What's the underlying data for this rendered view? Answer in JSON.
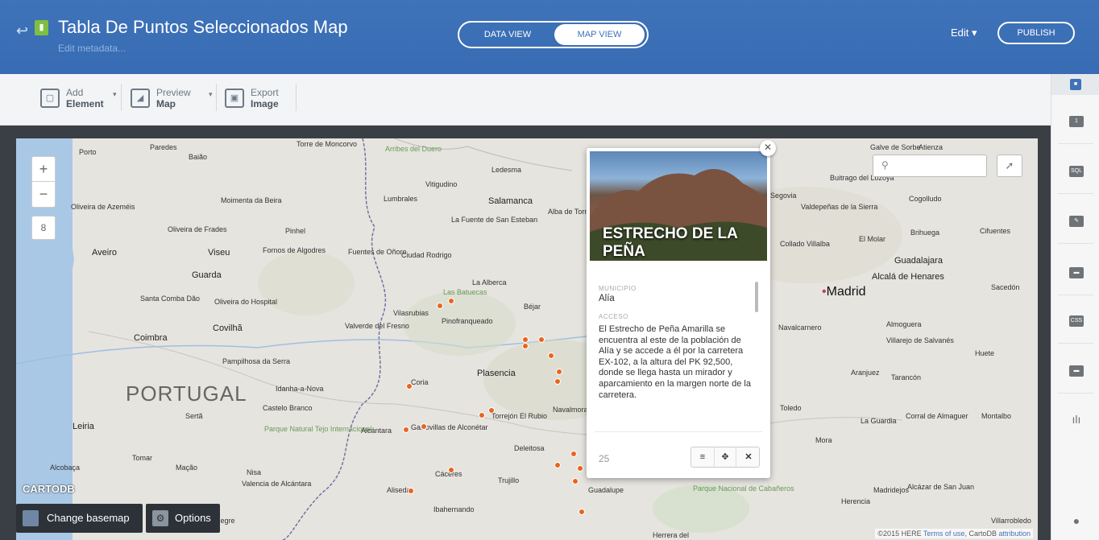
{
  "header": {
    "back_icon": "back-arrow-icon",
    "title": "Tabla De Puntos Seleccionados Map",
    "subtitle": "Edit metadata...",
    "view_switch": {
      "data_view": "DATA VIEW",
      "map_view": "MAP VIEW",
      "active": "MAP VIEW"
    },
    "edit_label": "Edit",
    "publish_label": "PUBLISH"
  },
  "toolbar": {
    "add": {
      "line1": "Add",
      "line2": "Element"
    },
    "preview": {
      "line1": "Preview",
      "line2": "Map"
    },
    "export": {
      "line1": "Export",
      "line2": "Image"
    }
  },
  "sidebar": {
    "items": [
      {
        "icon": "layer-1-icon",
        "label": "1"
      },
      {
        "icon": "sql-icon",
        "label": "SQL"
      },
      {
        "icon": "wizard-icon",
        "label": ""
      },
      {
        "icon": "infowindow-icon",
        "label": ""
      },
      {
        "icon": "css-icon",
        "label": "CSS"
      },
      {
        "icon": "legend-icon",
        "label": ""
      },
      {
        "icon": "filters-icon",
        "label": ""
      }
    ]
  },
  "map": {
    "zoom_in": "+",
    "zoom_out": "−",
    "zoom_level": "8",
    "search_placeholder": "",
    "country_label": "PORTUGAL",
    "main_city": "Madrid",
    "cartodb_logo": "CARTODB",
    "basemap_label": "Change basemap",
    "options_label": "Options",
    "attribution_prefix": "©2015 HERE ",
    "attribution_terms": "Terms of use",
    "attribution_mid": ", CartoDB ",
    "attribution_link": "attribution",
    "point_color": "#e8651e",
    "place_labels": [
      "Porto",
      "Paredes",
      "Baião",
      "Torre de Moncorvo",
      "Arribes del Duero",
      "Ledesma",
      "Vitigudino",
      "Oliveira de Azeméis",
      "Moimenta da Beira",
      "Lumbrales",
      "Salamanca",
      "Alba de Tormes",
      "Aveiro",
      "Viseu",
      "Oliveira de Frades",
      "Pinhel",
      "La Fuente de San Esteban",
      "Fornos de Algodres",
      "Fuentes de Oñoro",
      "Ciudad Rodrigo",
      "Guarda",
      "La Alberca",
      "Las Batuecas",
      "Santa Comba Dão",
      "Oliveira do Hospital",
      "Béjar",
      "Vilasrubias",
      "Pinofranqueado",
      "Coimbra",
      "Covilhã",
      "Valverde del Fresno",
      "Pampilhosa da Serra",
      "Plasencia",
      "Coria",
      "Idanha-a-Nova",
      "Castelo Branco",
      "Sertã",
      "Leiria",
      "Parque Natural Tejo Internacional",
      "Alcántara",
      "Garrovillas de Alconétar",
      "Torrejón El Rubio",
      "Navalmoral de la Mata",
      "Tomar",
      "Alcobaça",
      "Mação",
      "Nisa",
      "Valencia de Alcántara",
      "Cáceres",
      "Trujillo",
      "Guadalupe",
      "Aliseda",
      "Deleitosa",
      "Ibahernando",
      "Herrera del",
      "Portalegre",
      "Buitrago del Lozoya",
      "Galve de Sorbe",
      "Atienza",
      "Cogolludo",
      "Valdepeñas de la Sierra",
      "Brihuega",
      "Cifuentes",
      "El Molar",
      "Collado Villalba",
      "Guadalajara",
      "Alcalá de Henares",
      "Sacedón",
      "Navalcarnero",
      "Almoguera",
      "Villarejo de Salvanés",
      "Huete",
      "Aranjuez",
      "Tarancón",
      "Toledo",
      "La Guardia",
      "Corral de Almaguer",
      "Montalbo",
      "Mora",
      "Madridejos",
      "Alcázar de San Juan",
      "Herencia",
      "Villarrobledo",
      "Parque Nacional de Cabañeros",
      "Segovia"
    ]
  },
  "popup": {
    "title": "ESTRECHO DE LA PEÑA",
    "close_icon": "close-icon",
    "field1_label": "MUNICIPIO",
    "field1_value": "Alía",
    "field2_label": "ACCESO",
    "field2_value": "El Estrecho de Peña Amarilla se encuentra al este de la población de Alía y se accede a él por la carretera EX-102, a la altura del PK 92,500, donde se llega hasta un mirador y aparcamiento en la margen norte de la carretera.",
    "record_id": "25",
    "buttons": [
      "list-icon",
      "move-icon",
      "close-icon"
    ]
  }
}
